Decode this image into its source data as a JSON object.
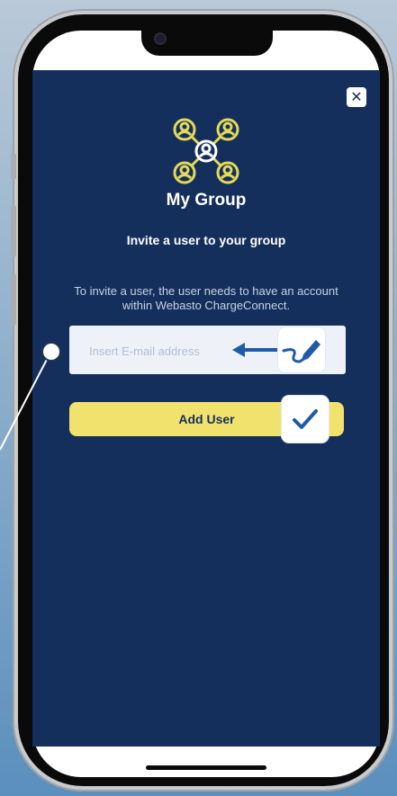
{
  "header": {
    "title": "My Group",
    "subtitle": "Invite a user to your group",
    "close_icon": "close-icon"
  },
  "main": {
    "description": "To invite a user, the user needs to have an account within Webasto ChargeConnect.",
    "email": {
      "placeholder": "Insert E-mail address",
      "value": ""
    },
    "add_button_label": "Add User"
  },
  "icons": {
    "group": "group-icon",
    "edit": "pen-edit-icon",
    "confirm": "checkmark-icon",
    "arrow": "arrow-left-icon"
  },
  "colors": {
    "app_background": "#142f5c",
    "accent_yellow": "#f1e26d",
    "input_background": "#eef2f8",
    "icon_blue": "#1e5aa8"
  }
}
